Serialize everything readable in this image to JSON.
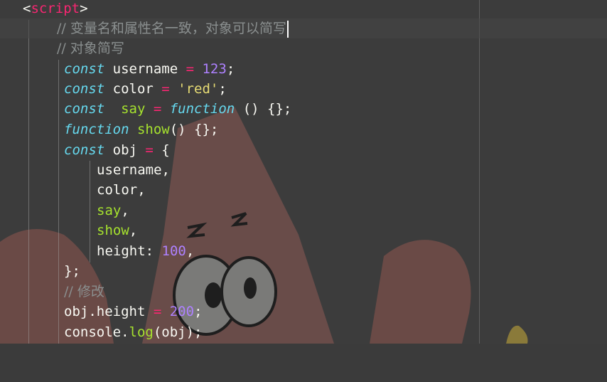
{
  "code": {
    "line1": {
      "open": "<",
      "tag": "script",
      "close": ">"
    },
    "line2": {
      "comment": "// 变量名和属性名一致，对象可以简写"
    },
    "line3": {
      "comment": "// 对象简写"
    },
    "line4": {
      "kw": "const",
      "name": " username ",
      "op": "=",
      "num": " 123",
      "end": ";"
    },
    "line5": {
      "kw": "const",
      "name": " color ",
      "op": "=",
      "str": " 'red'",
      "end": ";"
    },
    "line6": {
      "kw": "const",
      "name": "  say ",
      "op": "=",
      "kw2": " function",
      "end": " () {};"
    },
    "line7": {
      "kw": "function",
      "fn": " show",
      "end": "() {};"
    },
    "line8": {
      "kw": "const",
      "name": " obj ",
      "op": "=",
      "end": " {"
    },
    "line9": {
      "text": "username,"
    },
    "line10": {
      "text": "color,"
    },
    "line11": {
      "fn": "say",
      "end": ","
    },
    "line12": {
      "fn": "show",
      "end": ","
    },
    "line13": {
      "name": "height: ",
      "num": "100",
      "end": ","
    },
    "line14": {
      "text": "};"
    },
    "line15": {
      "comment": "// 修改"
    },
    "line16": {
      "name": "obj.height ",
      "op": "=",
      "num": " 200",
      "end": ";"
    },
    "line17": {
      "name": "console.",
      "fn": "log",
      "end": "(obj);"
    }
  },
  "colors": {
    "keyword": "#66d9ef",
    "operator": "#f92672",
    "number": "#ae81ff",
    "string": "#e6db74",
    "function": "#a6e22e",
    "comment": "#8a8f8f"
  }
}
